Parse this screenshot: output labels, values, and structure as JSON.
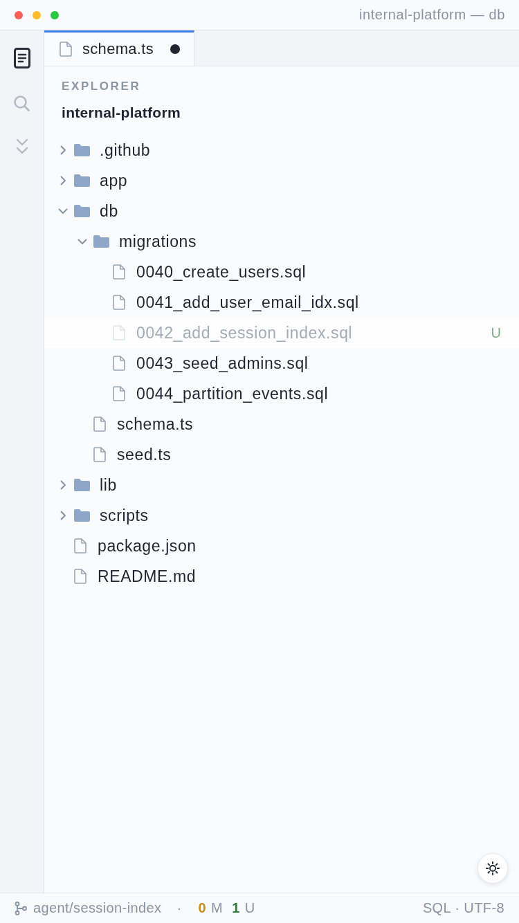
{
  "window": {
    "title": "internal-platform — db"
  },
  "activity_bar": {
    "items": [
      {
        "kind": "explorer",
        "selected": true
      },
      {
        "kind": "search",
        "selected": false
      },
      {
        "kind": "collapse",
        "selected": false
      }
    ]
  },
  "tabs": [
    {
      "label": "schema.ts",
      "selected": true,
      "modified": true
    }
  ],
  "explorer": {
    "heading": "EXPLORER",
    "root": "internal-platform",
    "tree": [
      {
        "kind": "folder",
        "name": ".github",
        "expanded": false
      },
      {
        "kind": "folder",
        "name": "app",
        "expanded": false
      },
      {
        "kind": "folder",
        "name": "db",
        "expanded": true,
        "children": [
          {
            "kind": "folder",
            "name": "migrations",
            "expanded": true,
            "children": [
              {
                "kind": "file",
                "name": "0040_create_users.sql",
                "faded": false
              },
              {
                "kind": "file",
                "name": "0041_add_user_email_idx.sql",
                "faded": false
              },
              {
                "kind": "file",
                "name": "0042_add_session_index.sql",
                "faded": true,
                "badge": "U"
              },
              {
                "kind": "file",
                "name": "0043_seed_admins.sql",
                "faded": false
              },
              {
                "kind": "file",
                "name": "0044_partition_events.sql",
                "faded": false
              }
            ]
          },
          {
            "kind": "file",
            "name": "schema.ts",
            "faded": false
          },
          {
            "kind": "file",
            "name": "seed.ts",
            "faded": false
          }
        ]
      },
      {
        "kind": "folder",
        "name": "lib",
        "expanded": false
      },
      {
        "kind": "folder",
        "name": "scripts",
        "expanded": false
      },
      {
        "kind": "file",
        "name": "package.json",
        "faded": false
      },
      {
        "kind": "file",
        "name": "README.md",
        "faded": false
      }
    ]
  },
  "status_bar": {
    "branch": "agent/session-index",
    "separator": "·",
    "modified_count": "0",
    "modified_label": "M",
    "untracked_count": "1",
    "untracked_label": "U",
    "encoding": "SQL · UTF-8"
  }
}
